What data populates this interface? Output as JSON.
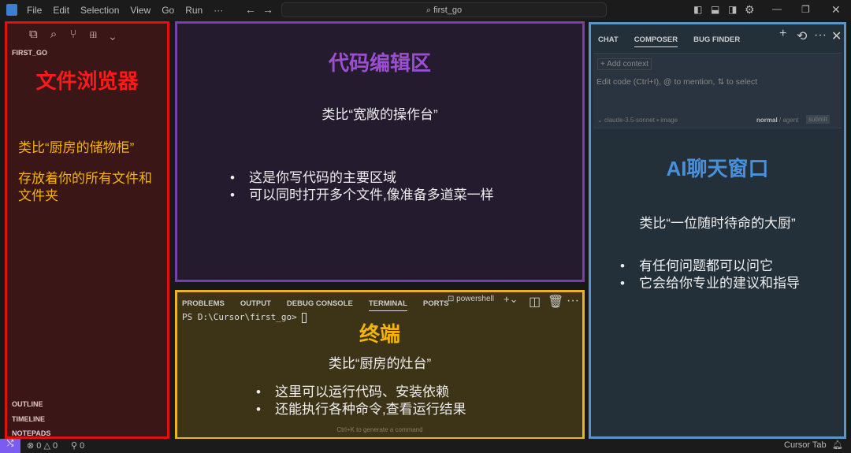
{
  "titlebar": {
    "menu": [
      "File",
      "Edit",
      "Selection",
      "View",
      "Go",
      "Run",
      "···"
    ],
    "search": "first_go"
  },
  "explorer": {
    "folder": "FIRST_GO",
    "title": "文件浏览器",
    "analogy": "类比“厨房的储物柜”",
    "desc": "存放着你的所有文件和文件夹",
    "sections": [
      "OUTLINE",
      "TIMELINE",
      "NOTEPADS"
    ]
  },
  "editor": {
    "title": "代码编辑区",
    "analogy": "类比“宽敞的操作台”",
    "bullets": [
      "这是你写代码的主要区域",
      "可以同时打开多个文件,像准备多道菜一样"
    ]
  },
  "terminal": {
    "tabs": [
      "PROBLEMS",
      "OUTPUT",
      "DEBUG CONSOLE",
      "TERMINAL",
      "PORTS"
    ],
    "shell": "powershell",
    "prompt": "PS D:\\Cursor\\first_go>",
    "title": "终端",
    "analogy": "类比“厨房的灶台”",
    "bullets": [
      "这里可以运行代码、安装依赖",
      "还能执行各种命令,查看运行结果"
    ],
    "hint": "Ctrl+K to generate a command"
  },
  "chat": {
    "tabs": [
      "CHAT",
      "COMPOSER",
      "BUG FINDER"
    ],
    "add_context": "+ Add context",
    "placeholder": "Edit code (Ctrl+I), @ to mention, ⇅ to select",
    "model": "claude-3.5-sonnet",
    "image": "image",
    "mode_normal": "normal",
    "mode_agent": "agent",
    "submit": "submit",
    "title": "AI聊天窗口",
    "analogy": "类比“一位随时待命的大厨”",
    "bullets": [
      "有任何问题都可以问它",
      "它会给你专业的建议和指导"
    ]
  },
  "status": {
    "errors": "0",
    "warnings": "0",
    "ports": "0",
    "cursor_tab": "Cursor Tab"
  },
  "colors": {
    "explorer": "#e01010",
    "editor": "#7a3ea8",
    "terminal": "#e8b420",
    "chat": "#5b94c9"
  }
}
